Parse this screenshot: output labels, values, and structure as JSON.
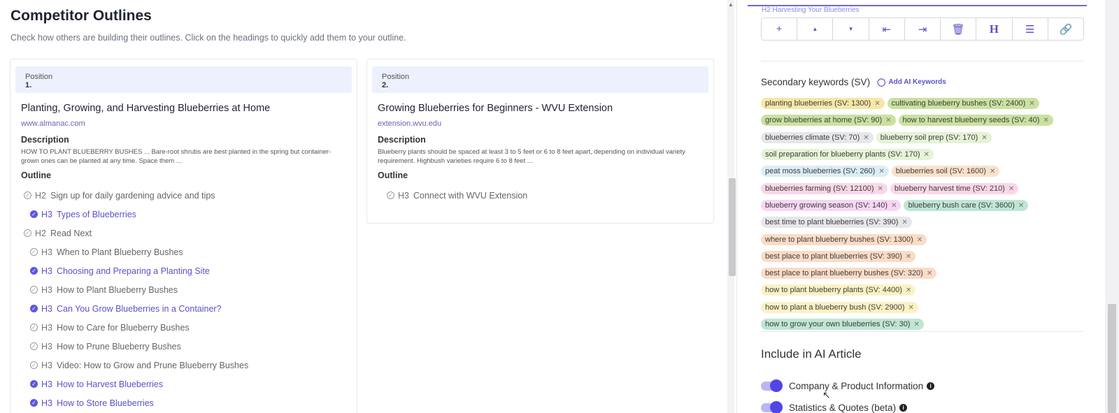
{
  "competitor": {
    "title": "Competitor Outlines",
    "subtitle": "Check how others are building their outlines. Click on the headings to quickly add them to your outline.",
    "cards": [
      {
        "position_label": "Position",
        "position_num": "1.",
        "title": "Planting, Growing, and Harvesting Blueberries at Home",
        "url": "www.almanac.com",
        "description_label": "Description",
        "description": "HOW TO PLANT BLUEBERRY BUSHES ... Bare-root shrubs are best planted in the spring but container-grown ones can be planted at any time. Space them ...",
        "outline_label": "Outline",
        "outline": [
          {
            "level": "H2",
            "text": "Sign up for daily gardening advice and tips",
            "selected": false
          },
          {
            "level": "H3",
            "text": "Types of Blueberries",
            "selected": true
          },
          {
            "level": "H2",
            "text": "Read Next",
            "selected": false
          },
          {
            "level": "H3",
            "text": "When to Plant Blueberry Bushes",
            "selected": false
          },
          {
            "level": "H3",
            "text": "Choosing and Preparing a Planting Site",
            "selected": true
          },
          {
            "level": "H3",
            "text": "How to Plant Blueberry Bushes",
            "selected": false
          },
          {
            "level": "H3",
            "text": "Can You Grow Blueberries in a Container?",
            "selected": true
          },
          {
            "level": "H3",
            "text": "How to Care for Blueberry Bushes",
            "selected": false
          },
          {
            "level": "H3",
            "text": "How to Prune Blueberry Bushes",
            "selected": false
          },
          {
            "level": "H3",
            "text": "Video: How to Grow and Prune Blueberry Bushes",
            "selected": false
          },
          {
            "level": "H3",
            "text": "How to Harvest Blueberries",
            "selected": true
          },
          {
            "level": "H3",
            "text": "How to Store Blueberries",
            "selected": true
          }
        ]
      },
      {
        "position_label": "Position",
        "position_num": "2.",
        "title": "Growing Blueberries for Beginners - WVU Extension",
        "url": "extension.wvu.edu",
        "description_label": "Description",
        "description": "Blueberry plants should be spaced at least 3 to 5 feet or 6 to 8 feet apart, depending on individual variety requirement. Highbush varieties require 6 to 8 feet ...",
        "outline_label": "Outline",
        "outline": [
          {
            "level": "H3",
            "text": "Connect with WVU Extension",
            "selected": false
          }
        ]
      }
    ]
  },
  "editor": {
    "partial_heading": "H2 Harvesting Your Blueberries",
    "toolbar_icons": [
      "plus-icon",
      "move-up-icon",
      "move-down-icon",
      "outdent-icon",
      "indent-icon",
      "trash-icon",
      "heading-icon",
      "list-icon",
      "link-icon"
    ]
  },
  "secondary_keywords": {
    "label": "Secondary keywords (SV)",
    "add_ai_label": "Add AI Keywords",
    "tags": [
      {
        "text": "planting blueberries (SV: 1300)",
        "color": "#f7e7a6"
      },
      {
        "text": "cultivating blueberry bushes (SV: 2400)",
        "color": "#c9e2a0"
      },
      {
        "text": "grow blueberries at home (SV: 90)",
        "color": "#c9e2a0"
      },
      {
        "text": "how to harvest blueberry seeds (SV: 40)",
        "color": "#c9e2a0"
      },
      {
        "text": "blueberries climate (SV: 70)",
        "color": "#e6e7ea"
      },
      {
        "text": "blueberry soil prep (SV: 170)",
        "color": "#e6f3d6"
      },
      {
        "text": "soil preparation for blueberry plants (SV: 170)",
        "color": "#e6f3d6"
      },
      {
        "text": "peat moss blueberries (SV: 260)",
        "color": "#dbeef4"
      },
      {
        "text": "blueberries soil (SV: 1600)",
        "color": "#fbe1cc"
      },
      {
        "text": "blueberries farming (SV: 12100)",
        "color": "#fad7e8"
      },
      {
        "text": "blueberry harvest time (SV: 210)",
        "color": "#fad7e8"
      },
      {
        "text": "blueberry growing season (SV: 140)",
        "color": "#f6d6f4"
      },
      {
        "text": "blueberry bush care (SV: 3600)",
        "color": "#bfe6d4"
      },
      {
        "text": "best time to plant blueberries (SV: 390)",
        "color": "#e6e7ea"
      },
      {
        "text": "where to plant blueberry bushes (SV: 1300)",
        "color": "#fbdcc6"
      },
      {
        "text": "best place to plant blueberries (SV: 390)",
        "color": "#fbdcc6"
      },
      {
        "text": "best place to plant blueberry bushes (SV: 320)",
        "color": "#fbdcc6"
      },
      {
        "text": "how to plant blueberry plants (SV: 4400)",
        "color": "#fbf2c4"
      },
      {
        "text": "how to plant a blueberry bush (SV: 2900)",
        "color": "#fbf2c4"
      },
      {
        "text": "how to grow your own blueberries (SV: 30)",
        "color": "#bfe6d4"
      }
    ]
  },
  "include": {
    "title": "Include in AI Article",
    "options": [
      {
        "label": "Company & Product Information",
        "on": true
      },
      {
        "label": "Statistics & Quotes (beta)",
        "on": true
      }
    ]
  }
}
